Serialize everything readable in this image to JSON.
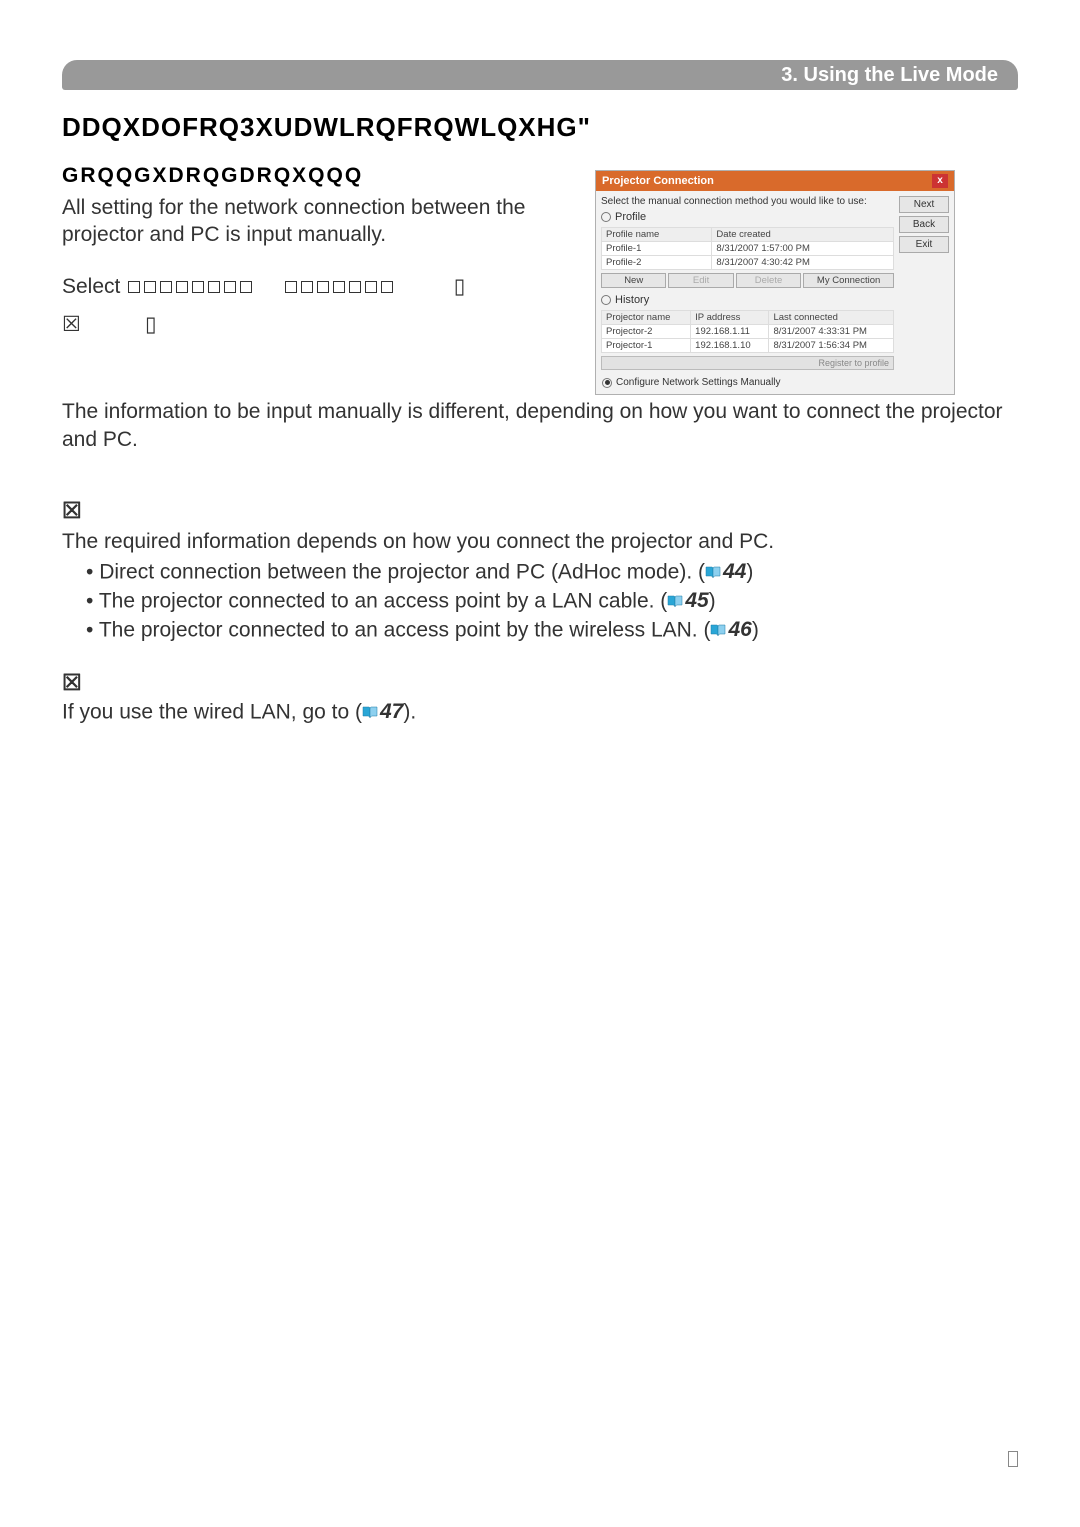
{
  "header": {
    "section_label": "3. Using the Live Mode"
  },
  "title_garbled": "DDQXDOFRQ3XUDWLRQFRQWLQXHG\"",
  "subtitle_garbled": "GRQQGXDRQGDRQXQQQ",
  "intro_p1": "All setting for the network connection between the projector and PC is input manually.",
  "select_prefix": "Select",
  "info_paragraph": "The information to be input manually is different, depending on how you want to connect the projector and PC.",
  "wireless_intro": "The required information depends on how you connect the projector and PC.",
  "bullets": [
    {
      "text": "Direct connection between the projector and PC (AdHoc mode). (",
      "page": "44",
      "suffix": ")"
    },
    {
      "text": "The projector connected to an access point by a LAN cable. (",
      "page": "45",
      "suffix": ")"
    },
    {
      "text": "The projector connected to an access point by the wireless LAN. (",
      "page": "46",
      "suffix": ")"
    }
  ],
  "wired_line_prefix": "If you use the wired LAN, go to (",
  "wired_page": "47",
  "wired_line_suffix": ").",
  "marker_glyph": "☒",
  "placeholder_glyph": "▯",
  "screenshot": {
    "title": "Projector Connection",
    "close": "x",
    "instruction": "Select the manual connection method you would like to use:",
    "buttons": {
      "next": "Next",
      "back": "Back",
      "exit": "Exit"
    },
    "profile_radio": "Profile",
    "profile_table": {
      "headers": [
        "Profile name",
        "Date created"
      ],
      "rows": [
        [
          "Profile-1",
          "8/31/2007 1:57:00 PM"
        ],
        [
          "Profile-2",
          "8/31/2007 4:30:42 PM"
        ]
      ]
    },
    "profile_buttons": {
      "new": "New",
      "edit": "Edit",
      "delete": "Delete",
      "myconn": "My Connection"
    },
    "history_radio": "History",
    "history_table": {
      "headers": [
        "Projector name",
        "IP address",
        "Last connected"
      ],
      "rows": [
        [
          "Projector-2",
          "192.168.1.11",
          "8/31/2007 4:33:31 PM"
        ],
        [
          "Projector-1",
          "192.168.1.10",
          "8/31/2007 1:56:34 PM"
        ]
      ]
    },
    "register_label": "Register to profile",
    "manual_radio": "Configure Network Settings Manually"
  }
}
